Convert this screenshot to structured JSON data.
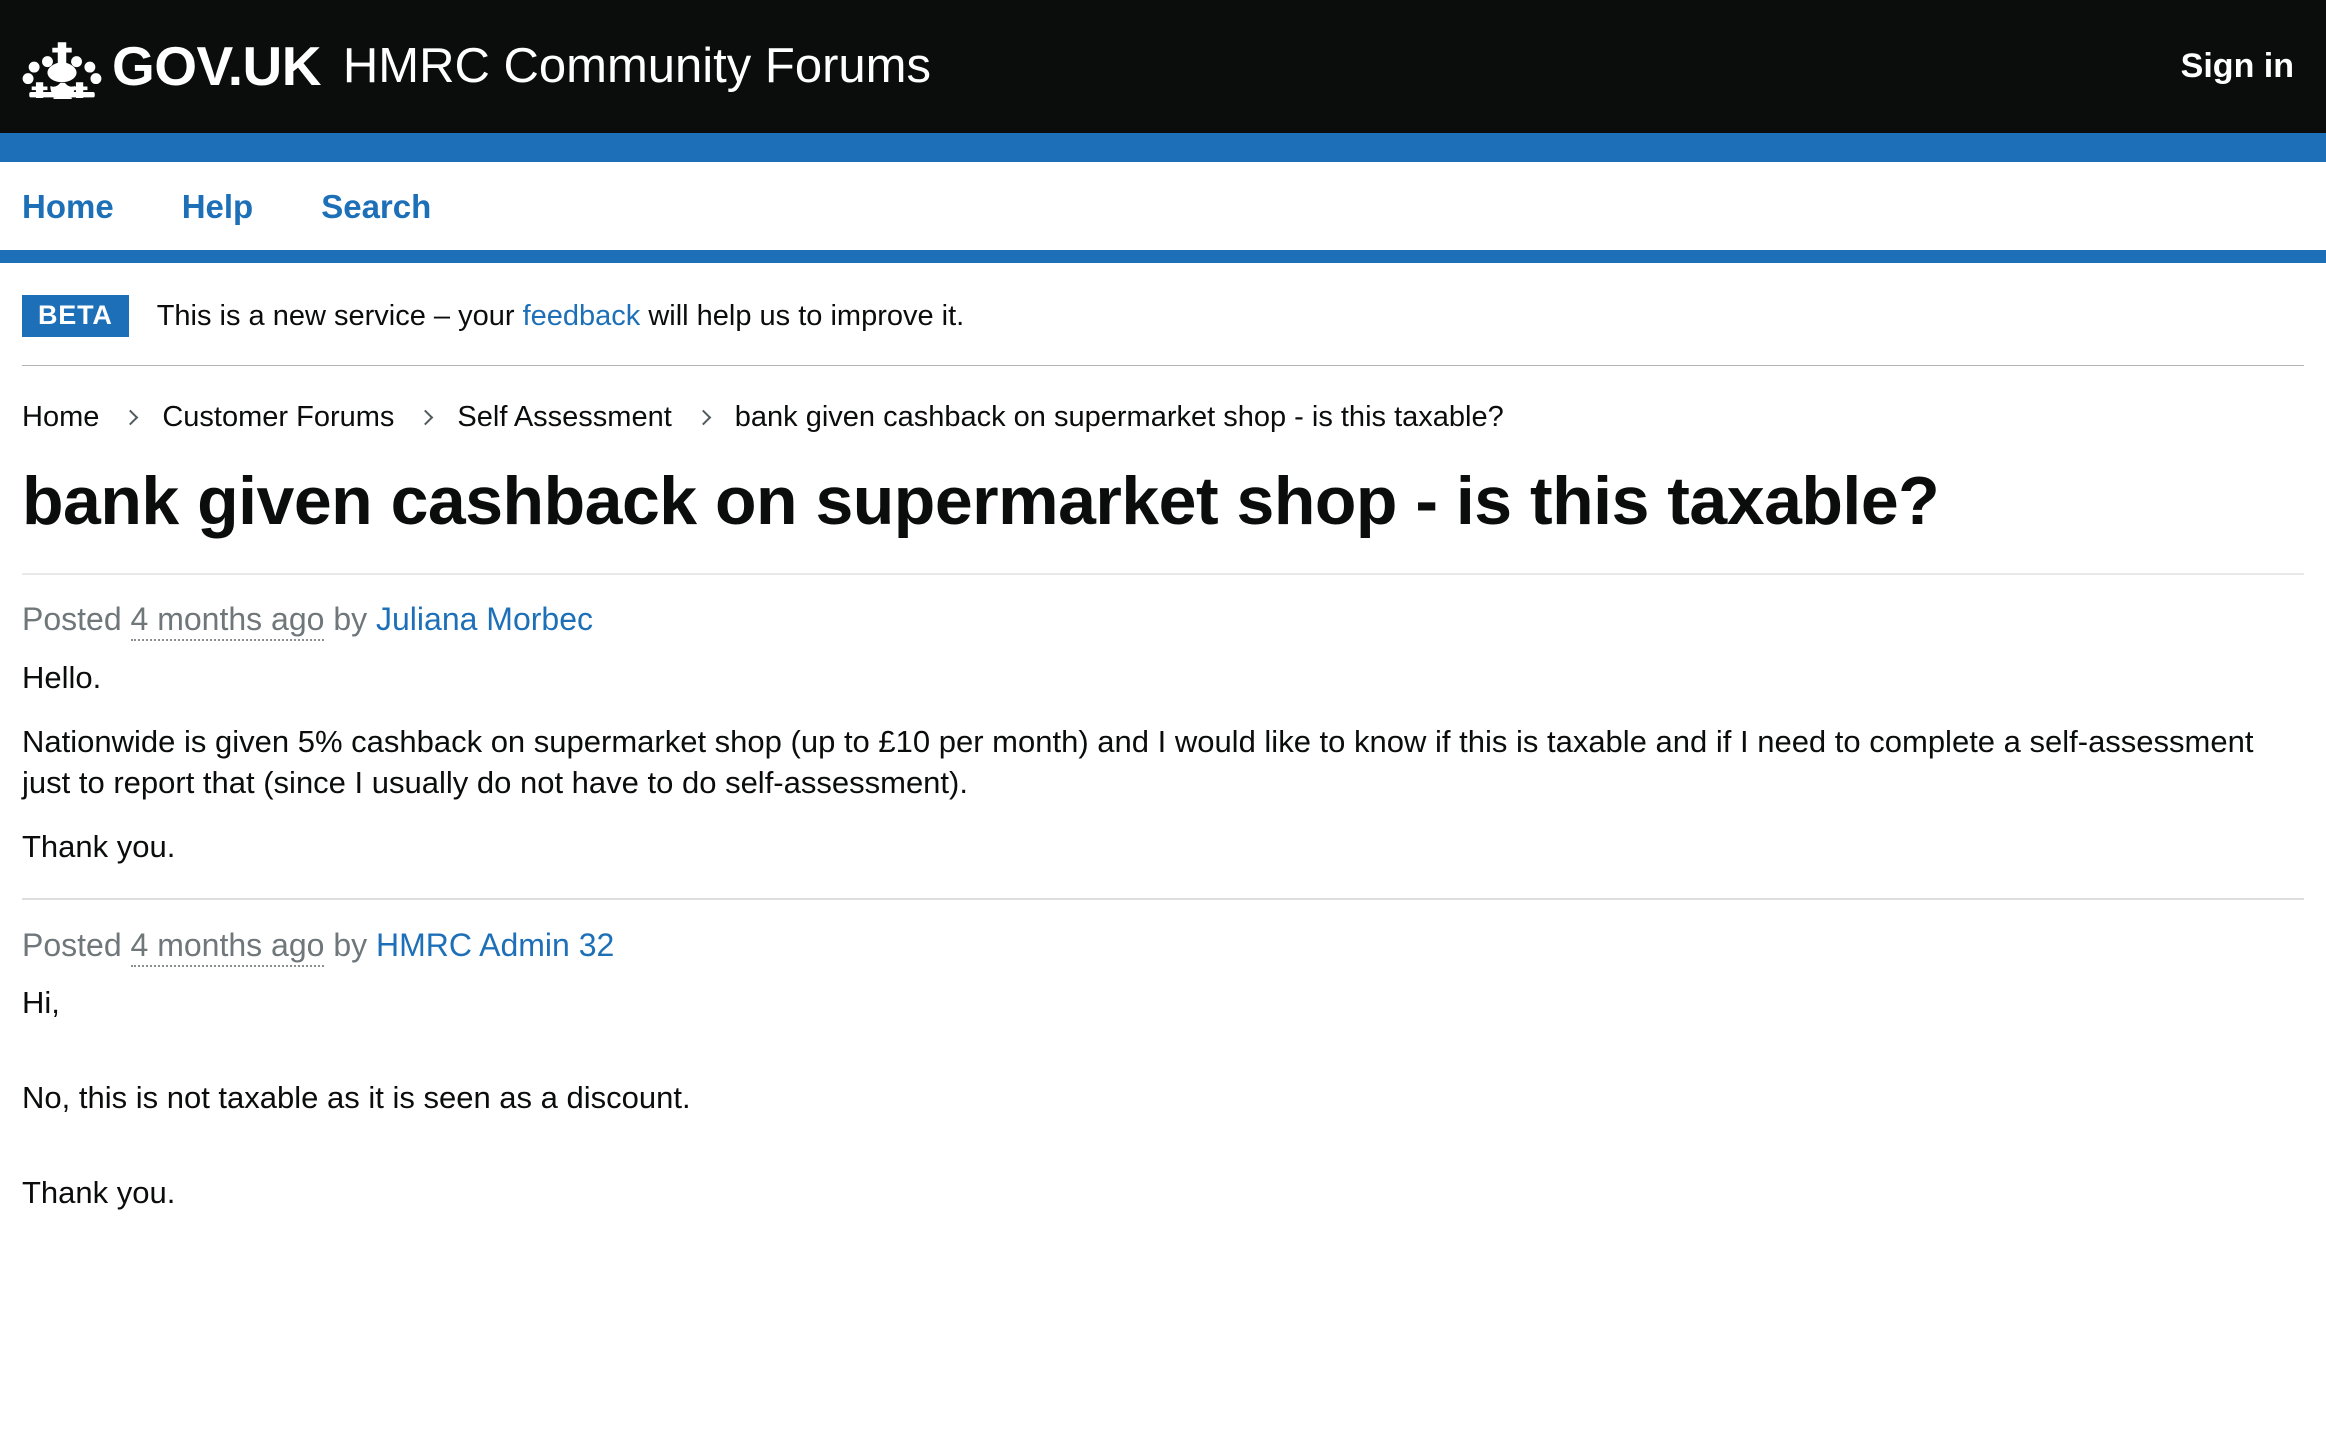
{
  "header": {
    "logo_text": "GOV.UK",
    "service_name": "HMRC Community Forums",
    "signin_label": "Sign in",
    "crown_icon": "crown-icon",
    "background_color": "#0b0c0c",
    "accent_color": "#1d70b8"
  },
  "nav": {
    "items": [
      {
        "label": "Home"
      },
      {
        "label": "Help"
      },
      {
        "label": "Search"
      }
    ]
  },
  "phase_banner": {
    "tag": "BETA",
    "text_before": "This is a new service – your ",
    "link": "feedback",
    "text_after": " will help us to improve it."
  },
  "breadcrumbs": {
    "items": [
      {
        "label": "Home"
      },
      {
        "label": "Customer Forums"
      },
      {
        "label": "Self Assessment"
      },
      {
        "label": "bank given cashback on supermarket shop - is this taxable?"
      }
    ]
  },
  "page": {
    "title": "bank given cashback on supermarket shop - is this taxable?"
  },
  "posts": [
    {
      "posted_prefix": "Posted ",
      "time_ago": "4 months ago",
      "by_label": " by ",
      "author": "Juliana Morbec",
      "paragraphs": [
        "Hello.",
        "Nationwide is given 5% cashback on supermarket shop (up to £10 per month) and I would like to know if this is taxable and if I need to complete a self-assessment just to report that (since I usually do not have to do self-assessment).",
        "Thank you."
      ]
    },
    {
      "posted_prefix": "Posted ",
      "time_ago": "4 months ago",
      "by_label": " by ",
      "author": "HMRC Admin 32",
      "paragraphs": [
        "Hi,",
        "No, this is not taxable as it is seen as a discount.",
        "Thank you."
      ]
    }
  ]
}
